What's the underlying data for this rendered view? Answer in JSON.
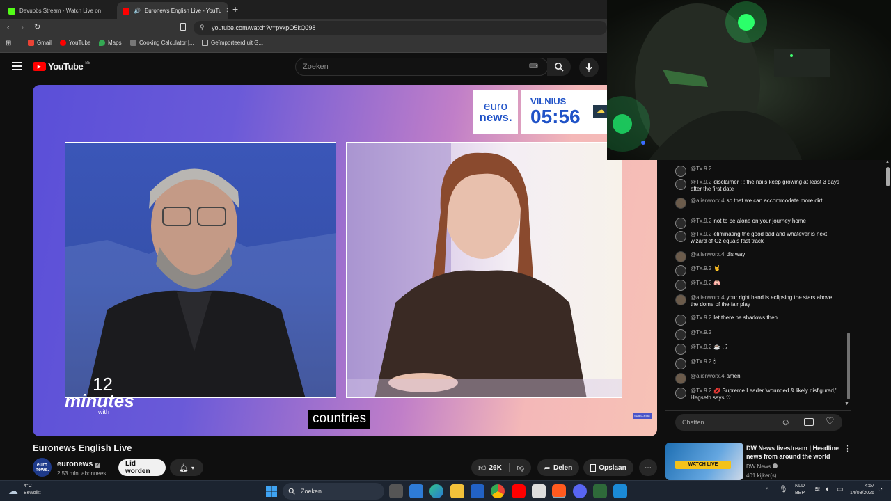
{
  "browser": {
    "tabs": [
      {
        "label": "Devubbs Stream - Watch Live on",
        "favicon_color": "#53fc18"
      },
      {
        "label": "Euronews English Live - YouTu",
        "favicon_color": "#ff0000"
      }
    ],
    "url": "youtube.com/watch?v=pykpO5kQJ98",
    "bookmarks": [
      {
        "label": "Gmail",
        "color": "#ea4335"
      },
      {
        "label": "YouTube",
        "color": "#ff0000"
      },
      {
        "label": "Maps",
        "color": "#34a853"
      },
      {
        "label": "Cooking Calculator |...",
        "color": "#777777"
      },
      {
        "label": "Geïmporteerd uit G...",
        "color": "#bbbbbb"
      }
    ]
  },
  "youtube": {
    "logo": "YouTube",
    "region": "BE",
    "search_placeholder": "Zoeken"
  },
  "video": {
    "brand_top": "euro",
    "brand_bottom": "news.",
    "city": "VILNIUS",
    "time": "05:56",
    "show_number": "12",
    "show_word": "minutes",
    "show_with": "with",
    "caption": "countries",
    "subscribe": "SUBSCRIBE",
    "title": "Euronews English Live"
  },
  "channel": {
    "name": "euronews",
    "avatar_top": "euro",
    "avatar_bottom": "news.",
    "subscribers": "2,53 mln. abonnees",
    "join_label": "Lid worden",
    "likes": "26K",
    "share_label": "Delen",
    "save_label": "Opslaan"
  },
  "chat": {
    "messages": [
      {
        "author": "@Tx.9.2",
        "text": "",
        "kind": "tx"
      },
      {
        "author": "@Tx.9.2",
        "text": "disclaimer : : the nails keep growing at least 3 days after the first date",
        "kind": "tx"
      },
      {
        "author": "@alienworx.4",
        "text": "so that we can accommodate more dirt",
        "kind": "al"
      },
      {
        "author": "@Tx.9.2",
        "text": "not to be alone on your journey home",
        "kind": "tx"
      },
      {
        "author": "@Tx.9.2",
        "text": "eliminating the good bad and whatever is next wizard of Oz equals fast track",
        "kind": "tx"
      },
      {
        "author": "@alienworx.4",
        "text": "dis way",
        "kind": "al"
      },
      {
        "author": "@Tx.9.2",
        "text": "🤘",
        "kind": "tx"
      },
      {
        "author": "@Tx.9.2",
        "text": "🫁",
        "kind": "tx"
      },
      {
        "author": "@alienworx.4",
        "text": "your right hand is eclipsing the stars above the dome of the fair play",
        "kind": "al"
      },
      {
        "author": "@Tx.9.2",
        "text": "let there be shadows then",
        "kind": "tx"
      },
      {
        "author": "@Tx.9.2",
        "text": "",
        "kind": "tx"
      },
      {
        "author": "@Tx.9.2",
        "text": "☕ ◡̈",
        "kind": "tx"
      },
      {
        "author": "@Tx.9.2",
        "text": "🕯",
        "kind": "tx"
      },
      {
        "author": "@alienworx.4",
        "text": "amen",
        "kind": "al"
      },
      {
        "author": "@Tx.9.2",
        "text": "💋 Supreme Leader 'wounded & likely disfigured,' Hegseth says ♡",
        "kind": "tx"
      }
    ],
    "input_placeholder": "Chatten..."
  },
  "recommended": {
    "title": "DW News livestream | Headline news from around the world",
    "channel": "DW News",
    "viewers": "401 kijker(s)",
    "badge": "WATCH LIVE"
  },
  "taskbar": {
    "weather_temp": "4°C",
    "weather_desc": "Bewolkt",
    "search_label": "Zoeken",
    "lang_top": "NLD",
    "lang_bottom": "BEP",
    "time": "4:57",
    "date": "14/03/2026"
  }
}
